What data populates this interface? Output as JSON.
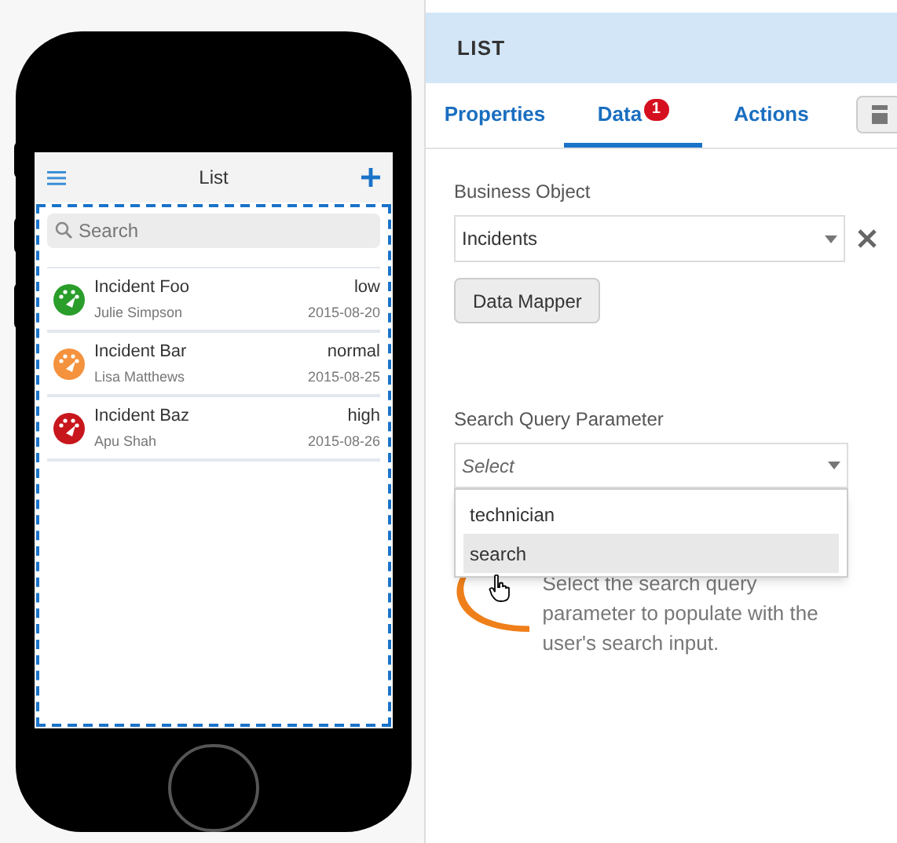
{
  "phone": {
    "title": "List",
    "search": {
      "placeholder": "Search"
    },
    "items": [
      {
        "title": "Incident Foo",
        "priority": "low",
        "person": "Julie Simpson",
        "date": "2015-08-20",
        "color": "#2a9d2a"
      },
      {
        "title": "Incident Bar",
        "priority": "normal",
        "person": "Lisa Matthews",
        "date": "2015-08-25",
        "color": "#f5923e"
      },
      {
        "title": "Incident Baz",
        "priority": "high",
        "person": "Apu Shah",
        "date": "2015-08-26",
        "color": "#c8161d"
      }
    ]
  },
  "panel": {
    "title": "LIST",
    "tabs": [
      {
        "label": "Properties",
        "selected": false
      },
      {
        "label": "Data",
        "selected": true,
        "badge": "1"
      },
      {
        "label": "Actions",
        "selected": false
      }
    ],
    "business_object": {
      "label": "Business Object",
      "value": "Incidents"
    },
    "data_mapper_button": "Data Mapper",
    "search_query_parameter": {
      "label": "Search Query Parameter",
      "placeholder": "Select",
      "expanded": true,
      "options": [
        {
          "label": "technician",
          "selected": false
        },
        {
          "label": "search",
          "selected": true
        }
      ]
    },
    "hint": {
      "lines": [
        "Select the search query",
        "parameter to populate with the",
        "user's search input."
      ]
    }
  }
}
